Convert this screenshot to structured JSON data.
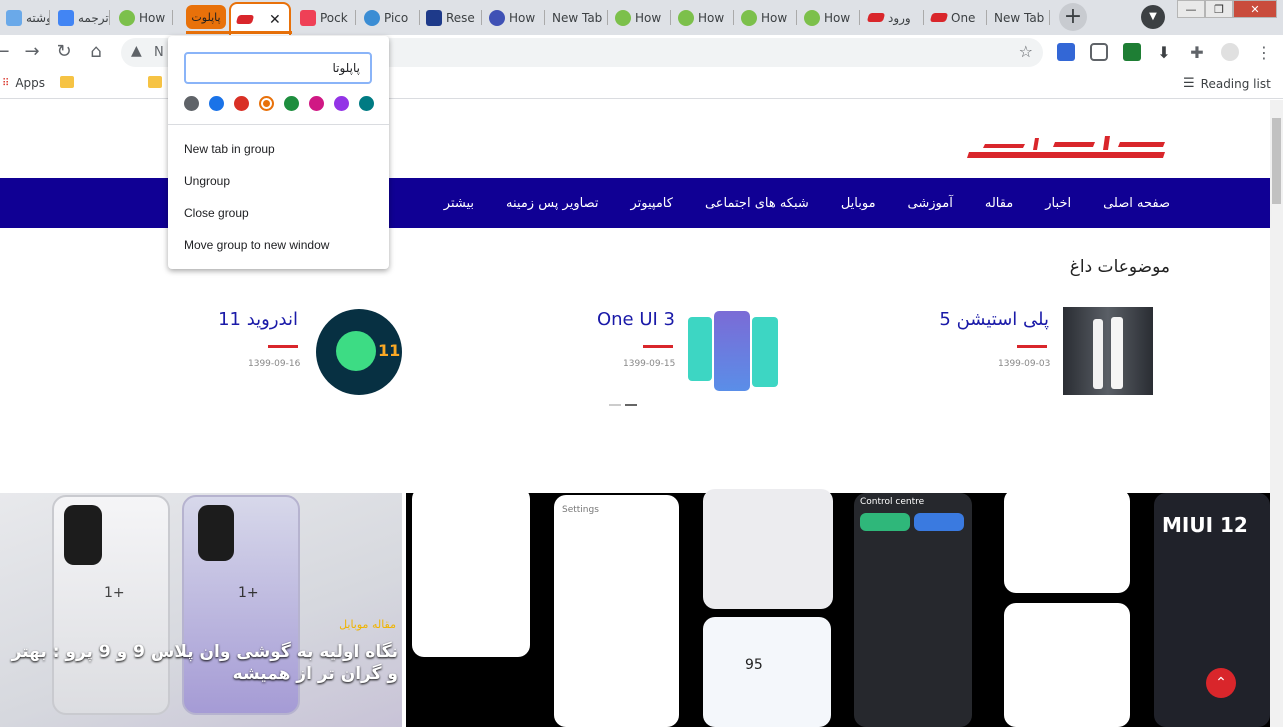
{
  "tabs": [
    {
      "label": "نوشته",
      "icon": "site-icon",
      "color": "#6aa9e9"
    },
    {
      "label": "ترجمه",
      "icon": "google-translate-icon",
      "color": "#4285f4"
    },
    {
      "label": "How",
      "icon": "frog-icon",
      "color": "#7cc04b"
    },
    {
      "label": "",
      "icon": "papilot-icon",
      "color": "#d9262b",
      "active": true
    },
    {
      "label": "Pock",
      "icon": "pocket-icon",
      "color": "#ef4056"
    },
    {
      "label": "Pico",
      "icon": "globe-icon",
      "color": "#3b8dd4"
    },
    {
      "label": "Rese",
      "icon": "gn-icon",
      "color": "#1e3a8a"
    },
    {
      "label": "How",
      "icon": "gt-icon",
      "color": "#3f51b5"
    },
    {
      "label": "New Tab",
      "icon": "",
      "color": ""
    },
    {
      "label": "How",
      "icon": "frog-icon",
      "color": "#7cc04b"
    },
    {
      "label": "How",
      "icon": "frog-icon",
      "color": "#7cc04b"
    },
    {
      "label": "How",
      "icon": "frog-icon",
      "color": "#7cc04b"
    },
    {
      "label": "How",
      "icon": "frog-icon",
      "color": "#7cc04b"
    },
    {
      "label": "ورود",
      "icon": "papilot-icon",
      "color": "#d9262b"
    },
    {
      "label": "One",
      "icon": "papilot-icon",
      "color": "#d9262b"
    },
    {
      "label": "New Tab",
      "icon": "",
      "color": ""
    }
  ],
  "tab_group": {
    "name": "پاپلوت",
    "color": "#e8710a"
  },
  "address_bar": {
    "text": "N",
    "warning_icon": "warning-icon"
  },
  "bookmarks": {
    "apps_label": "Apps",
    "reading_list_label": "Reading list"
  },
  "group_menu": {
    "name_value": "پاپلوتا",
    "colors": [
      "#5f6368",
      "#1a73e8",
      "#d93025",
      "#e8710a",
      "#1e8e3e",
      "#d01884",
      "#9334e6",
      "#007b83"
    ],
    "selected_color": "#e8710a",
    "items": [
      "New tab in group",
      "Ungroup",
      "Close group",
      "Move group to new window"
    ]
  },
  "site": {
    "nav": [
      "صفحه اصلی",
      "اخبار",
      "مقاله",
      "آموزشی",
      "موبایل",
      "شبکه های اجتماعی",
      "کامپیوتر",
      "تصاویر پس زمینه",
      "بیشتر"
    ],
    "tags_title": "موضوعات داغ",
    "cards": [
      {
        "title": "پلی استیشن 5",
        "date": "1399-09-03"
      },
      {
        "title": "One UI 3",
        "date": "1399-09-15"
      },
      {
        "title": "اندروید 11",
        "date": "1399-09-16"
      }
    ],
    "hero": {
      "category": "مقاله موبایل",
      "title": "نگاه اولیه به گوشی وان پلاس 9 و 9 پرو : بهتر و گران تر از همیشه"
    },
    "miui_label": "MIUI 12",
    "control_centre_label": "Control centre",
    "settings_label": "Settings",
    "android_badge": "11",
    "screen_number": "95"
  },
  "accent_colors": {
    "brand_red": "#d9262b",
    "nav_blue": "#100094",
    "group_orange": "#e8710a"
  }
}
